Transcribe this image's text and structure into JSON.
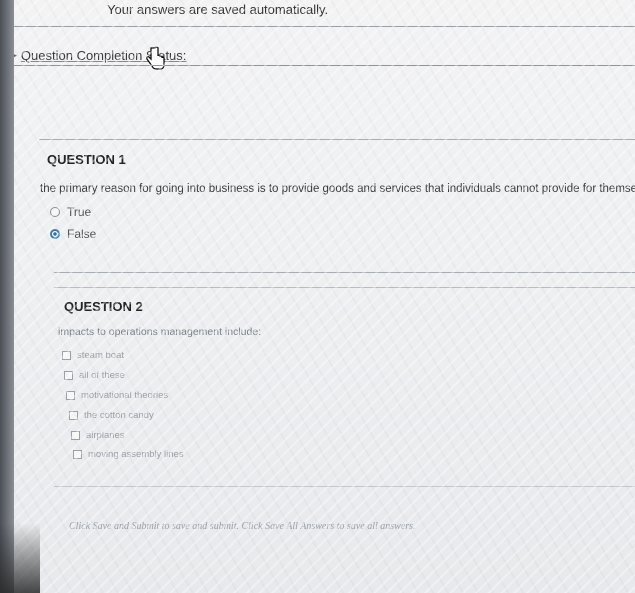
{
  "header": {
    "saved_notice": "Your answers are saved automatically."
  },
  "status": {
    "label": "Question Completion Status:"
  },
  "question1": {
    "title": "QUESTION 1",
    "text": "the primary reason for going into business is to provide goods and services that individuals cannot provide for themselve",
    "options": [
      {
        "label": "True",
        "selected": false
      },
      {
        "label": "False",
        "selected": true
      }
    ]
  },
  "question2": {
    "title": "QUESTION 2",
    "text": "impacts to operations management include:",
    "options": [
      {
        "label": "steam boat"
      },
      {
        "label": "all of these"
      },
      {
        "label": "motivational theories"
      },
      {
        "label": "the cotton candy"
      },
      {
        "label": "airplanes"
      },
      {
        "label": "moving assembly lines"
      }
    ]
  },
  "footer": {
    "note": "Click Save and Submit to save and submit. Click Save All Answers to save all answers."
  },
  "colors": {
    "accent": "#2f6fa5",
    "background": "#eef0f2"
  }
}
